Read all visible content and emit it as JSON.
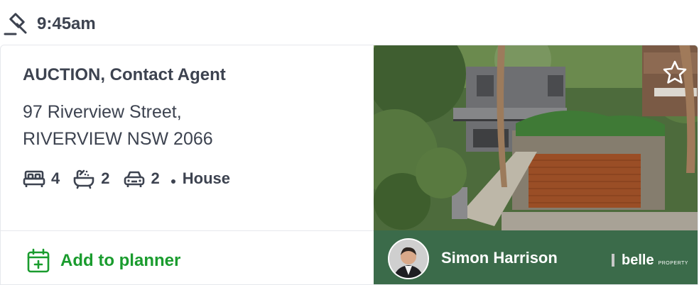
{
  "header": {
    "time": "9:45am",
    "gavel_icon": "gavel-icon"
  },
  "listing": {
    "headline": "AUCTION, Contact Agent",
    "address_line1": "97 Riverview Street,",
    "address_line2": "RIVERVIEW NSW 2066",
    "bedrooms": "4",
    "bathrooms": "2",
    "parking": "2",
    "property_type": "House",
    "icons": [
      "bed-icon",
      "bath-icon",
      "car-icon",
      "star-icon",
      "calendar-plus-icon"
    ]
  },
  "actions": {
    "planner_label": "Add to planner"
  },
  "agent": {
    "name": "Simon Harrison",
    "agency": "belle",
    "agency_suffix": "PROPERTY"
  },
  "colors": {
    "accent_green": "#1a9c2e",
    "agent_bar": "#3b6b4a",
    "text": "#3d4350"
  }
}
